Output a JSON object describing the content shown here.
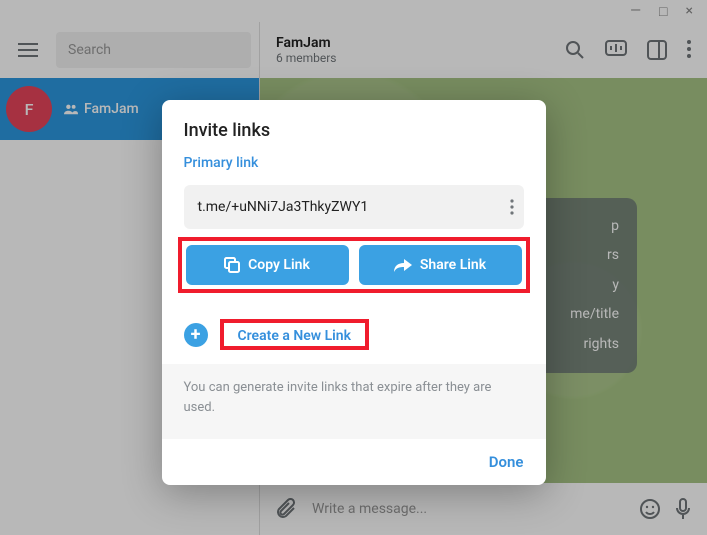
{
  "window": {
    "minimize": "—",
    "maximize": "□",
    "close": "×"
  },
  "sidebar": {
    "search_placeholder": "Search",
    "chat": {
      "avatar_letter": "F",
      "name": "FamJam"
    }
  },
  "header": {
    "title": "FamJam",
    "subtitle": "6 members"
  },
  "rights_panel": [
    "p",
    "rs",
    "y",
    "me/title",
    "rights"
  ],
  "composer": {
    "placeholder": "Write a message..."
  },
  "dialog": {
    "title": "Invite links",
    "primary_label": "Primary link",
    "link_value": "t.me/+uNNi7Ja3ThkyZWY1",
    "copy_label": "Copy Link",
    "share_label": "Share Link",
    "create_label": "Create a New Link",
    "description": "You can generate invite links that expire after they are used.",
    "done_label": "Done"
  }
}
